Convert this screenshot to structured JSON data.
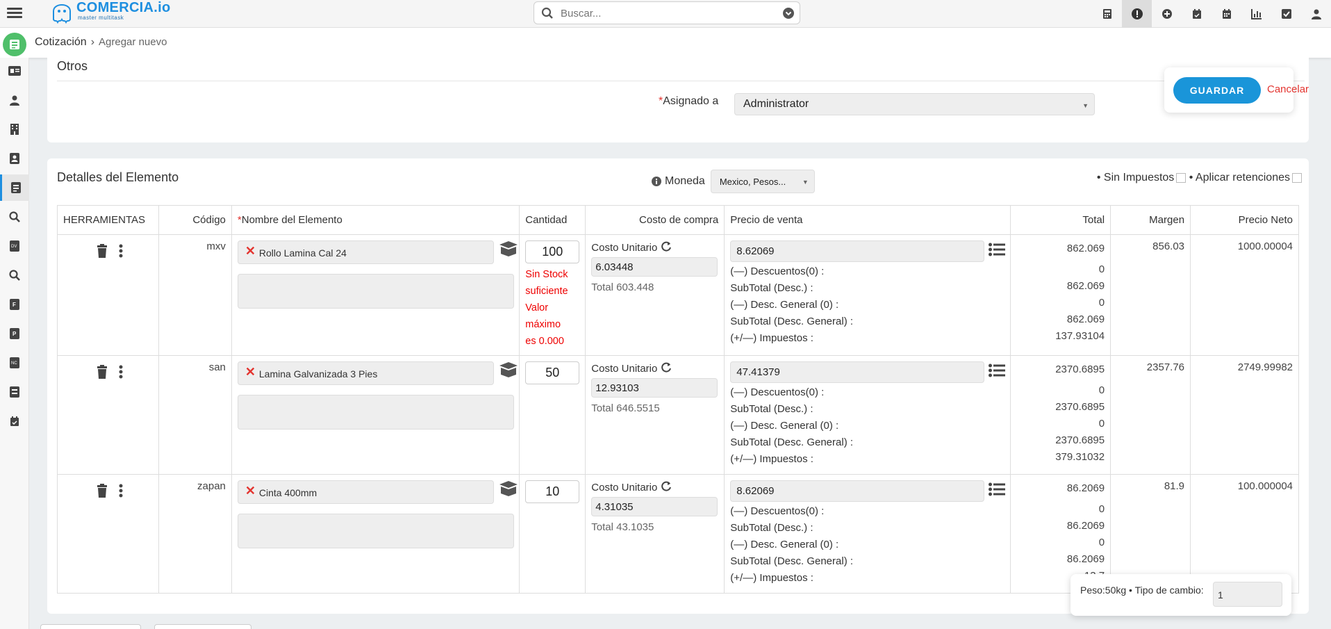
{
  "header": {
    "brand": "COMERCIA.io",
    "brand_sub": "master multitask",
    "search_placeholder": "Buscar..."
  },
  "breadcrumb": {
    "module": "Cotización",
    "current": "Agregar nuevo"
  },
  "otros": {
    "title": "Otros",
    "assigned_label": "Asignado a",
    "assigned_value": "Administrator",
    "save_label": "GUARDAR",
    "cancel_label": "Cancelar"
  },
  "details": {
    "title": "Detalles del Elemento",
    "currency_label": "Moneda",
    "currency_value": "Mexico, Pesos...",
    "no_tax_label": "• Sin Impuestos",
    "retentions_label": "• Aplicar retenciones",
    "columns": {
      "tools": "HERRAMIENTAS",
      "code": "Código",
      "name": "Nombre del Elemento",
      "qty": "Cantidad",
      "cost": "Costo de compra",
      "price": "Precio de venta",
      "total": "Total",
      "margin": "Margen",
      "net": "Precio Neto"
    },
    "unit_cost_label": "Costo Unitario",
    "discounts_label": "(—) Descuentos(0) :",
    "subtotal_label": "SubTotal (Desc.) :",
    "general_discount_label": "(—) Desc. General (0) :",
    "subtotal_general_label": "SubTotal (Desc. General) :",
    "taxes_label": "(+/—) Impuestos :",
    "rows": [
      {
        "code": "mxv",
        "name": "Rollo Lamina Cal 24",
        "qty": "100",
        "stock_warning": [
          "Sin Stock",
          "suficiente",
          "Valor",
          "máximo",
          "es 0.000"
        ],
        "unit_cost": "6.03448",
        "cost_total": "Total 603.448",
        "price": "8.62069",
        "totals": [
          "862.069",
          "0",
          "862.069",
          "0",
          "862.069",
          "137.93104"
        ],
        "margin": "856.03",
        "net": "1000.00004"
      },
      {
        "code": "san",
        "name": "Lamina Galvanizada 3 Pies",
        "qty": "50",
        "stock_warning": [],
        "unit_cost": "12.93103",
        "cost_total": "Total 646.5515",
        "price": "47.41379",
        "totals": [
          "2370.6895",
          "0",
          "2370.6895",
          "0",
          "2370.6895",
          "379.31032"
        ],
        "margin": "2357.76",
        "net": "2749.99982"
      },
      {
        "code": "zapan",
        "name": "Cinta 400mm",
        "qty": "10",
        "stock_warning": [],
        "unit_cost": "4.31035",
        "cost_total": "Total 43.1035",
        "price": "8.62069",
        "totals": [
          "86.2069",
          "0",
          "86.2069",
          "0",
          "86.2069",
          "13.7"
        ],
        "margin": "81.9",
        "net": "100.000004"
      }
    ]
  },
  "footer": {
    "weight_rate_label": "Peso:50kg • Tipo de cambio:",
    "exchange_rate": "1"
  },
  "colors": {
    "accent": "#1a95d9",
    "danger": "#e3342f",
    "module": "#4fbf6a"
  }
}
